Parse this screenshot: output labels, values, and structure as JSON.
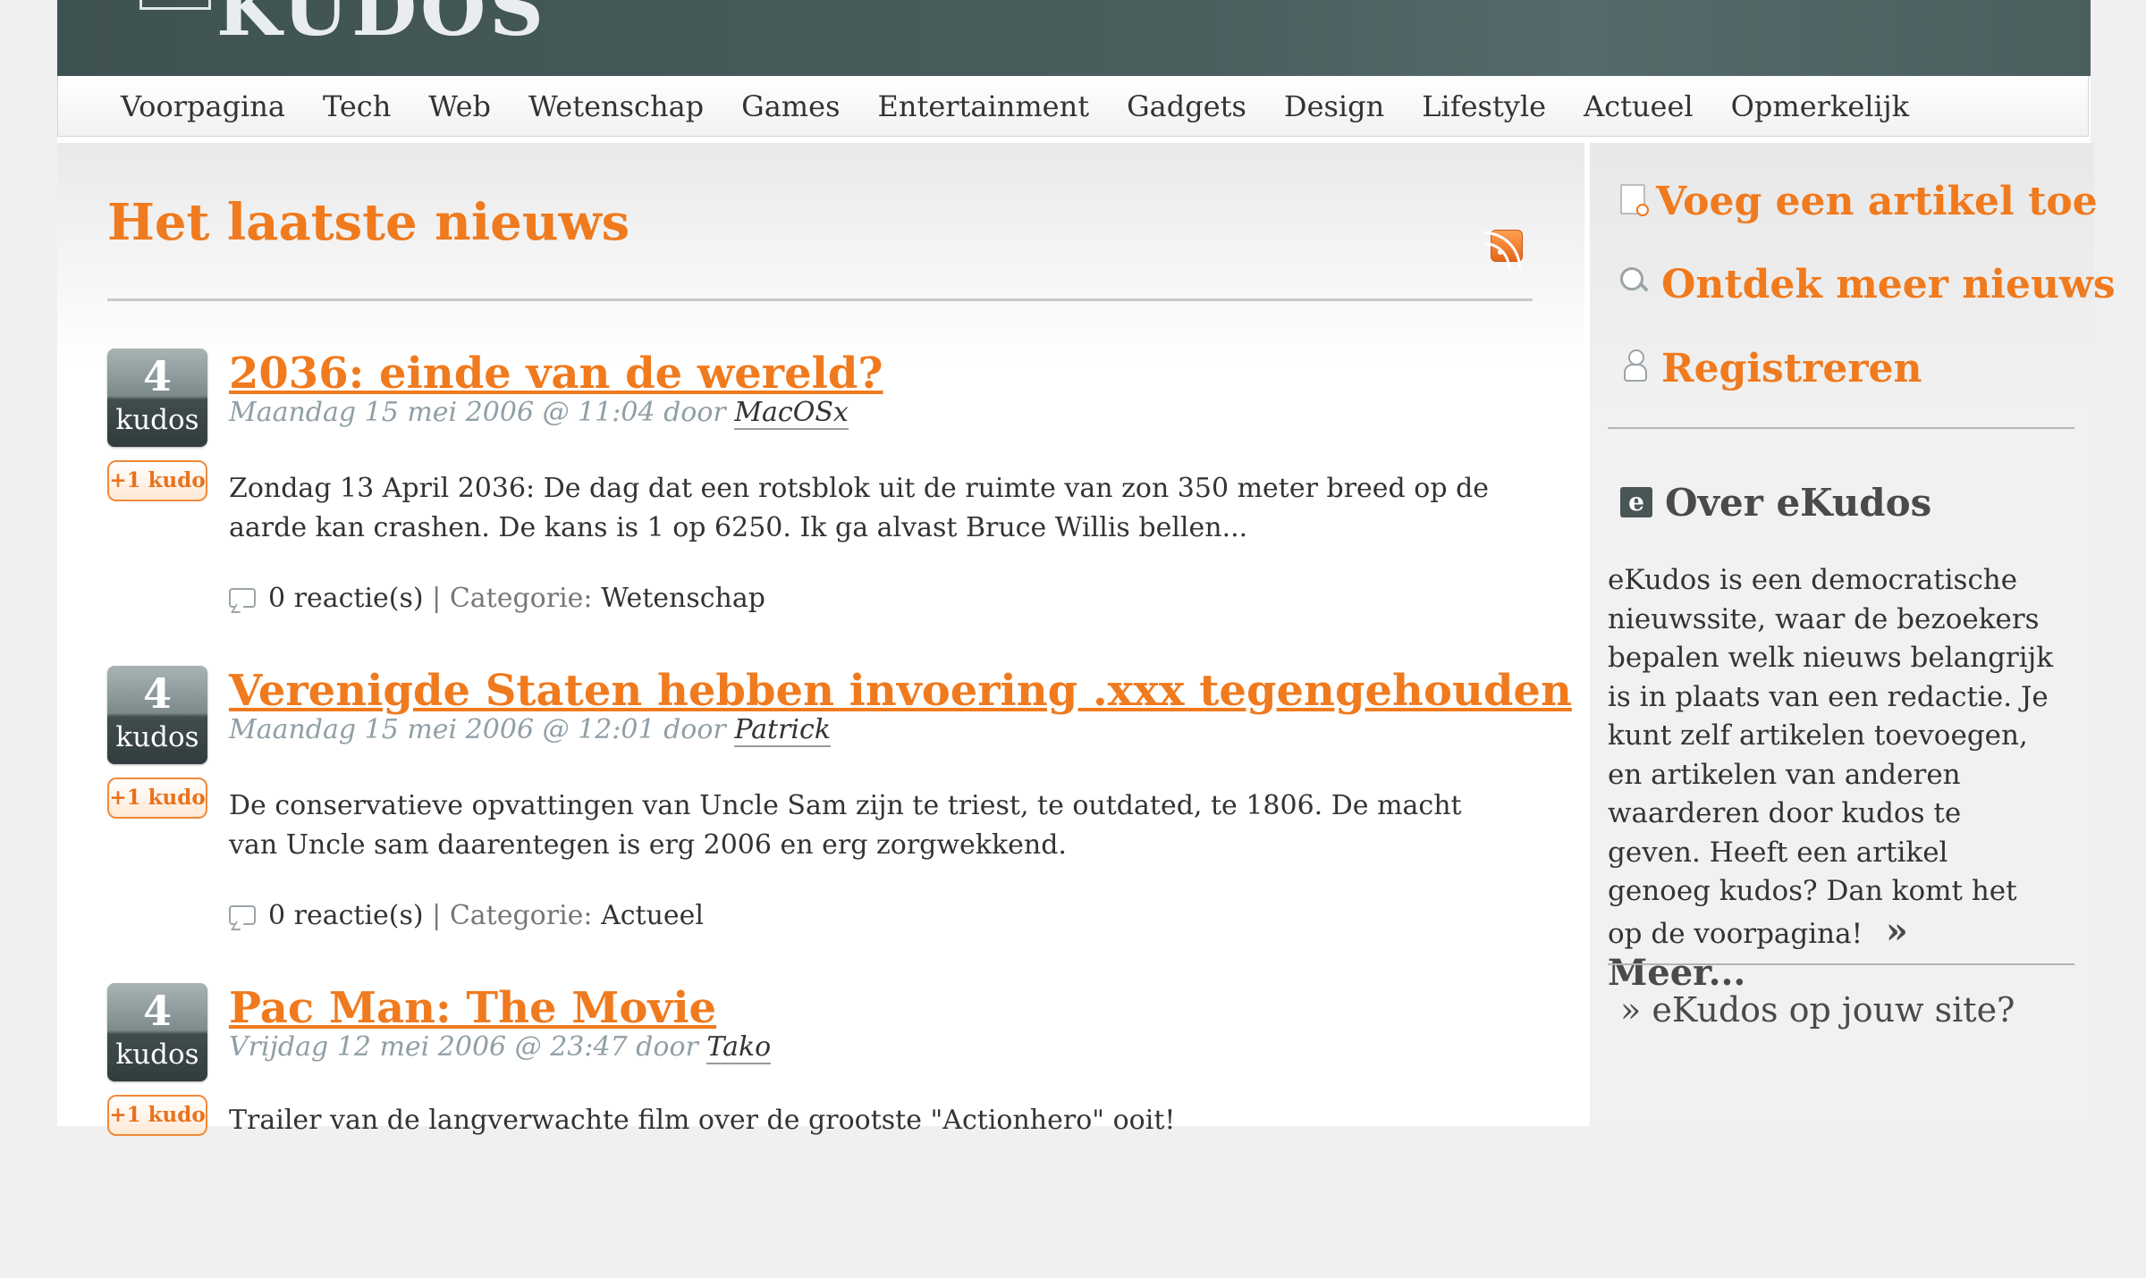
{
  "header": {
    "logo_text": "KUDOS"
  },
  "nav": {
    "items": [
      "Voorpagina",
      "Tech",
      "Web",
      "Wetenschap",
      "Games",
      "Entertainment",
      "Gadgets",
      "Design",
      "Lifestyle",
      "Actueel",
      "Opmerkelijk"
    ]
  },
  "main": {
    "title": "Het laatste nieuws",
    "rss_icon": "rss-feed-icon",
    "articles": [
      {
        "kudos_count": "4",
        "kudos_label": "kudos",
        "kudo_button": "+1 kudo",
        "title": "2036: einde van de wereld?",
        "meta": "Maandag 15 mei 2006 @ 11:04 door",
        "author": "MacOSx",
        "summary": "Zondag 13 April 2036: De dag dat een rotsblok uit de ruimte van zon 350 meter breed op de aarde kan crashen. De kans is 1 op 6250. Ik ga alvast Bruce Willis bellen...",
        "comments": "0 reactie(s)",
        "category_label": "| Categorie:",
        "category": "Wetenschap"
      },
      {
        "kudos_count": "4",
        "kudos_label": "kudos",
        "kudo_button": "+1 kudo",
        "title": "Verenigde Staten hebben invoering .xxx tegengehouden",
        "meta": "Maandag 15 mei 2006 @ 12:01 door",
        "author": "Patrick",
        "summary": "De conservatieve opvattingen van Uncle Sam zijn te triest, te outdated, te 1806. De macht van Uncle sam daarentegen is erg 2006 en erg zorgwekkend.",
        "comments": "0 reactie(s)",
        "category_label": "| Categorie:",
        "category": "Actueel"
      },
      {
        "kudos_count": "4",
        "kudos_label": "kudos",
        "kudo_button": "+1 kudo",
        "title": "Pac Man: The Movie",
        "meta": "Vrijdag 12 mei 2006 @ 23:47 door",
        "author": "Tako",
        "summary": "Trailer van de langverwachte film over de grootste \"Actionhero\" ooit!",
        "comments": "",
        "category_label": "",
        "category": ""
      }
    ]
  },
  "sidebar": {
    "add_article": "Voeg een artikel toe",
    "discover": "Ontdek meer nieuws",
    "register": "Registreren",
    "about_title": "Over eKudos",
    "about_text": "eKudos is een democratische nieuwssite, waar de bezoekers bepalen welk nieuws belangrijk is in plaats van een redactie. Je kunt zelf artikelen toevoegen, en artikelen van anderen waarderen door kudos te geven. Heeft een artikel genoeg kudos? Dan komt het op de voorpagina!",
    "more_link": "» Meer...",
    "site_link": "» eKudos op jouw site?"
  },
  "colors": {
    "accent": "#f07a1e",
    "banner": "#4a5e5e"
  }
}
